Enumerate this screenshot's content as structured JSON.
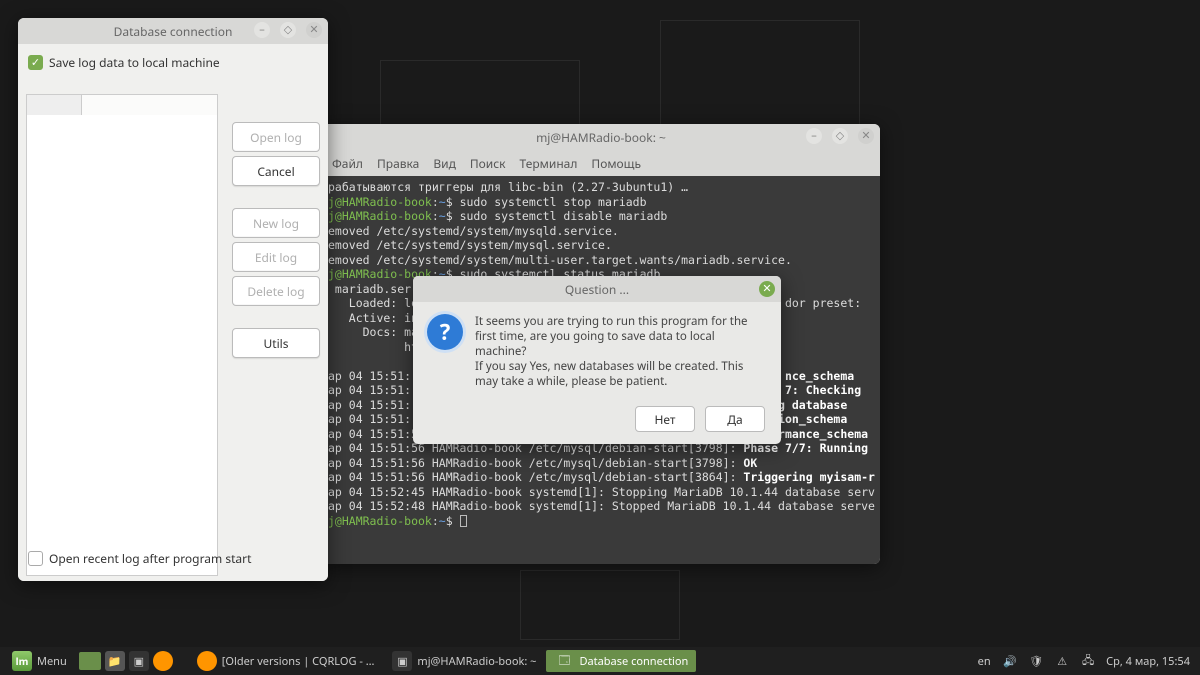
{
  "db_window": {
    "title": "Database connection",
    "save_log_label": "Save log data to local machine",
    "save_log_checked": true,
    "buttons": {
      "open_log": "Open log",
      "cancel": "Cancel",
      "new_log": "New log",
      "edit_log": "Edit log",
      "delete_log": "Delete log",
      "utils": "Utils"
    },
    "open_recent_label": "Open recent log after program start",
    "open_recent_checked": false
  },
  "terminal": {
    "title": "mj@HAMRadio-book: ~",
    "menu": [
      "Файл",
      "Правка",
      "Вид",
      "Поиск",
      "Терминал",
      "Помощь"
    ],
    "lines": [
      {
        "raw": "рабатываются триггеры для libc-bin (2.27-3ubuntu1) …"
      },
      {
        "prompt": true,
        "cmd": "sudo systemctl stop mariadb"
      },
      {
        "prompt": true,
        "cmd": "sudo systemctl disable mariadb"
      },
      {
        "raw": "emoved /etc/systemd/system/mysqld.service."
      },
      {
        "raw": "emoved /etc/systemd/system/mysql.service."
      },
      {
        "raw": "emoved /etc/systemd/system/multi-user.target.wants/mariadb.service."
      },
      {
        "prompt": true,
        "cmd": "sudo systemctl status mariadb"
      },
      {
        "raw": " mariadb.ser                                                                "
      },
      {
        "raw": "   Loaded: lo                                                     dor preset:"
      },
      {
        "raw": "   Active: in"
      },
      {
        "raw": "     Docs: ma"
      },
      {
        "raw": "           ht"
      },
      {
        "raw": ""
      },
      {
        "raw": "ap 04 15:51:                                                      ",
        "tail": "nce_schema",
        "bold": true
      },
      {
        "raw": "ap 04 15:51:                                                      ",
        "tail": "7: Checking",
        "bold": true
      },
      {
        "raw": "ap 04 15:51:                                                    ",
        "tail": "ng database",
        "bold": true
      },
      {
        "raw": "ap 04 15:51:                                                     ",
        "tail": "ion_schema",
        "bold": true
      },
      {
        "raw": "ap 04 15:51:56 HAMRadio-book /etc/mysql/debian-start[3798]: ",
        "tail": "performance_schema",
        "bold": true
      },
      {
        "raw": "ap 04 15:51:56 HAMRadio-book /etc/mysql/debian-start[3798]: ",
        "tail": "Phase 7/7: Running",
        "bold": true
      },
      {
        "raw": "ap 04 15:51:56 HAMRadio-book /etc/mysql/debian-start[3798]: ",
        "tail": "OK",
        "bold": true
      },
      {
        "raw": "ap 04 15:51:56 HAMRadio-book /etc/mysql/debian-start[3864]: ",
        "tail": "Triggering myisam-r",
        "bold": true
      },
      {
        "raw": "ap 04 15:52:45 HAMRadio-book systemd[1]: Stopping MariaDB 10.1.44 database serv"
      },
      {
        "raw": "ap 04 15:52:48 HAMRadio-book systemd[1]: Stopped MariaDB 10.1.44 database serve"
      },
      {
        "prompt": true,
        "cmd": "",
        "cursor": true
      }
    ],
    "prompt_user": "j@HAMRadio-book",
    "prompt_path": "~",
    "prompt_sep": ":",
    "prompt_dollar": "$"
  },
  "question": {
    "title": "Question ...",
    "text": "It seems you are trying to run this program for the first time, are you going to save data to local machine?\nIf you say Yes, new databases will be created. This may take a while, please be patient.",
    "no": "Нет",
    "yes": "Да"
  },
  "taskbar": {
    "menu": "Menu",
    "items": [
      {
        "label": "[Older versions | CQRLOG - …",
        "icon": "ff"
      },
      {
        "label": "mj@HAMRadio-book: ~",
        "icon": "term"
      },
      {
        "label": "Database connection",
        "icon": "app",
        "active": true
      }
    ],
    "lang": "en",
    "clock": "Ср,  4 мар, 15:54"
  }
}
